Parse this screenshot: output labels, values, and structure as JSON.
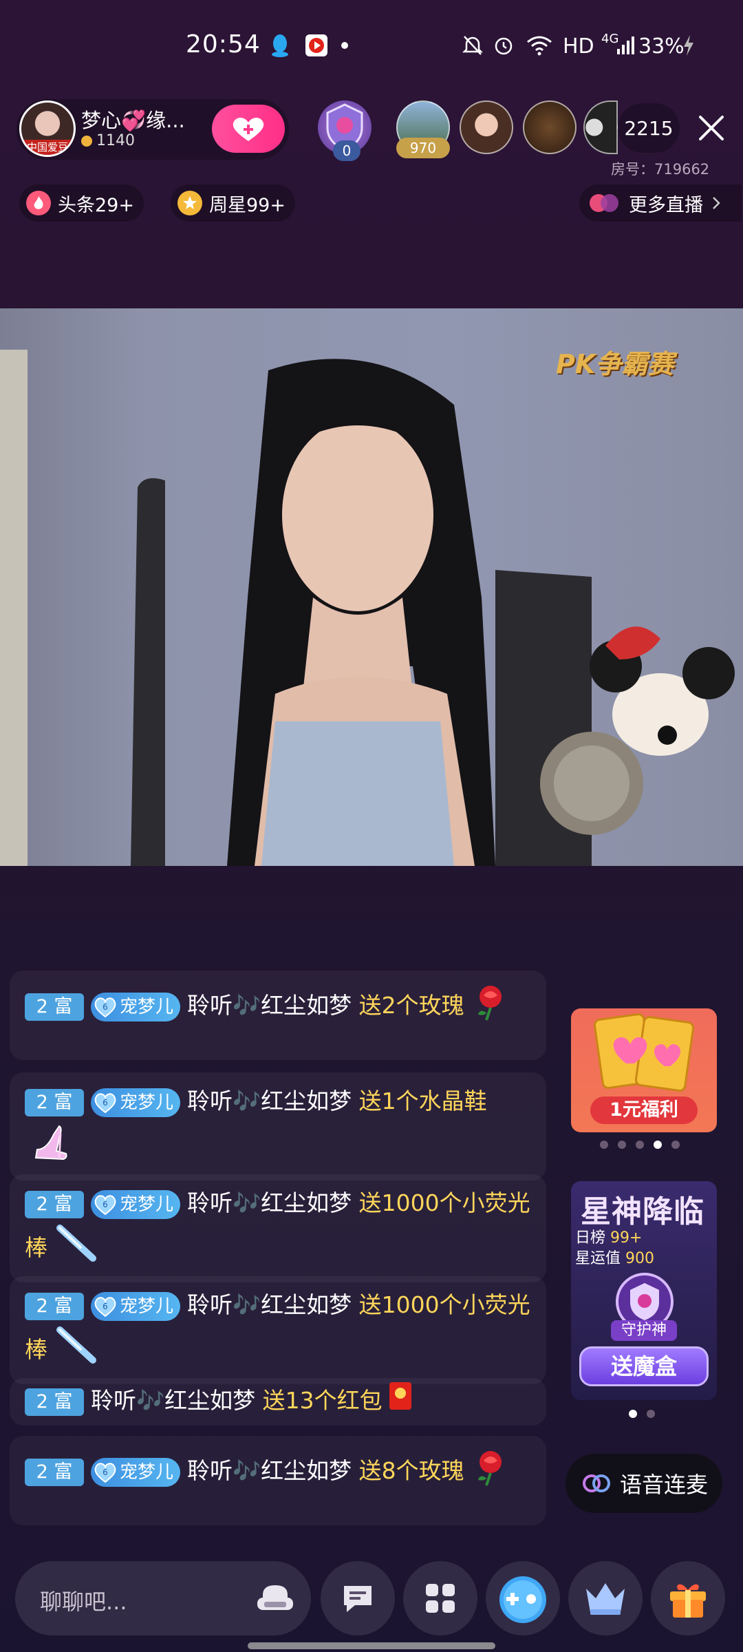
{
  "status_bar": {
    "time": "20:54",
    "network": "HD",
    "signal": "4G",
    "battery": "33%",
    "icons": [
      "qq-icon",
      "video-app-icon",
      "dot-icon",
      "mute-icon",
      "alarm-icon",
      "wifi-icon",
      "signal-icon",
      "charging-icon"
    ]
  },
  "anchor": {
    "name": "梦心💞缘...",
    "coins": "1140",
    "avatar_tag": "中国爱豆"
  },
  "viewers": {
    "badge_first": "0",
    "badge_second": "970",
    "count": "2215"
  },
  "room": {
    "number_label": "房号：719662"
  },
  "chips": {
    "headline": "头条29+",
    "weekstar": "周星99+",
    "more_live": "更多直播"
  },
  "video": {
    "overlay_logo": "PK争霸赛"
  },
  "chat": [
    {
      "level": "2 富",
      "fan_badge": "宠梦儿",
      "has_fan": true,
      "user": "聆听🎶红尘如梦",
      "gift": "送2个玫瑰",
      "gift_icon": "rose-icon"
    },
    {
      "level": "2 富",
      "fan_badge": "宠梦儿",
      "has_fan": true,
      "user": "聆听🎶红尘如梦",
      "gift": "送1个水晶鞋",
      "gift_icon": "crystal-shoe-icon"
    },
    {
      "level": "2 富",
      "fan_badge": "宠梦儿",
      "has_fan": true,
      "user": "聆听🎶红尘如梦",
      "gift": "送1000个小荧光棒",
      "gift_icon": "glow-stick-icon"
    },
    {
      "level": "2 富",
      "fan_badge": "宠梦儿",
      "has_fan": true,
      "user": "聆听🎶红尘如梦",
      "gift": "送1000个小荧光棒",
      "gift_icon": "glow-stick-icon"
    },
    {
      "level": "2 富",
      "fan_badge": "",
      "has_fan": false,
      "user": "聆听🎶红尘如梦",
      "gift": "送13个红包",
      "gift_icon": "red-envelope-icon"
    },
    {
      "level": "2 富",
      "fan_badge": "宠梦儿",
      "has_fan": true,
      "user": "聆听🎶红尘如梦",
      "gift": "送8个玫瑰",
      "gift_icon": "rose-icon"
    }
  ],
  "banner_welfare": {
    "label": "1元福利",
    "dot_count": 5,
    "active_dot": 4
  },
  "banner_star": {
    "title": "星神降临",
    "daily_rank_label": "日榜",
    "daily_rank_value": "99+",
    "star_value_label": "星运值",
    "star_value": "900",
    "guard_label": "守护神",
    "button": "送魔盒",
    "dot_count": 2,
    "active_dot": 1
  },
  "voice_link": {
    "label": "语音连麦"
  },
  "bottom_bar": {
    "input_placeholder": "聊聊吧...",
    "buttons": [
      "sofa-icon",
      "message-icon",
      "grid-icon",
      "game-icon",
      "crown-icon",
      "gift-icon"
    ]
  },
  "colors": {
    "accent_pink": "#ff2f86",
    "level_badge": "#4da3df",
    "gift_text": "#ffd65a",
    "background": "#2a1636"
  }
}
